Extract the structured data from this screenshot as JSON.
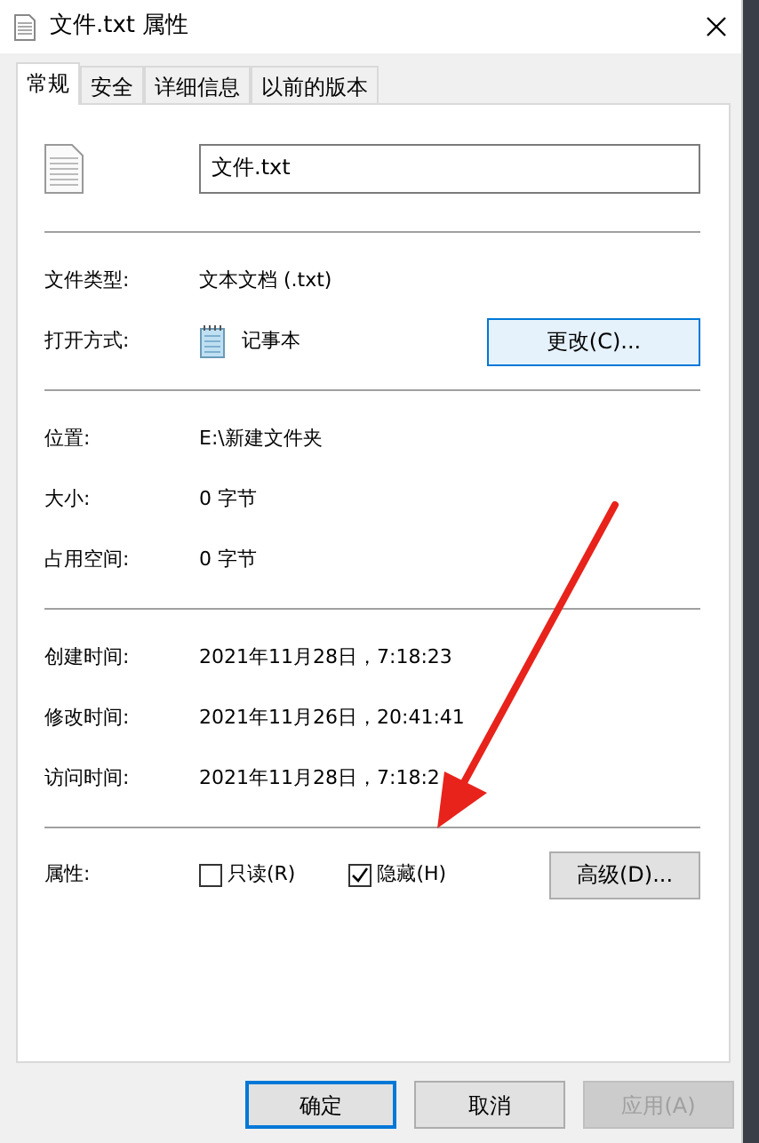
{
  "window": {
    "title": "文件.txt 属性"
  },
  "tabs": [
    {
      "label": "常规",
      "selected": true
    },
    {
      "label": "安全",
      "selected": false
    },
    {
      "label": "详细信息",
      "selected": false
    },
    {
      "label": "以前的版本",
      "selected": false
    }
  ],
  "file_name": "文件.txt",
  "groups": [
    {
      "rows": [
        {
          "kind": "text",
          "label": "文件类型:",
          "value": "文本文档 (.txt)"
        },
        {
          "kind": "app",
          "label": "打开方式:",
          "value": "记事本",
          "button": "更改(C)..."
        }
      ]
    },
    {
      "rows": [
        {
          "kind": "text",
          "label": "位置:",
          "value": "E:\\新建文件夹"
        },
        {
          "kind": "text",
          "label": "大小:",
          "value": "0 字节"
        },
        {
          "kind": "text",
          "label": "占用空间:",
          "value": "0 字节"
        }
      ]
    },
    {
      "rows": [
        {
          "kind": "text",
          "label": "创建时间:",
          "value": "2021年11月28日，7:18:23"
        },
        {
          "kind": "text",
          "label": "修改时间:",
          "value": "2021年11月26日，20:41:41"
        },
        {
          "kind": "text",
          "label": "访问时间:",
          "value": "2021年11月28日，7:18:2"
        }
      ]
    }
  ],
  "attributes": {
    "label": "属性:",
    "checkboxes": [
      {
        "label": "只读(R)",
        "checked": false
      },
      {
        "label": "隐藏(H)",
        "checked": true
      }
    ],
    "button": "高级(D)..."
  },
  "buttons": [
    {
      "label": "确定",
      "kind": "default",
      "disabled": false
    },
    {
      "label": "取消",
      "kind": "normal",
      "disabled": false
    },
    {
      "label": "应用(A)",
      "kind": "normal",
      "disabled": true
    }
  ]
}
